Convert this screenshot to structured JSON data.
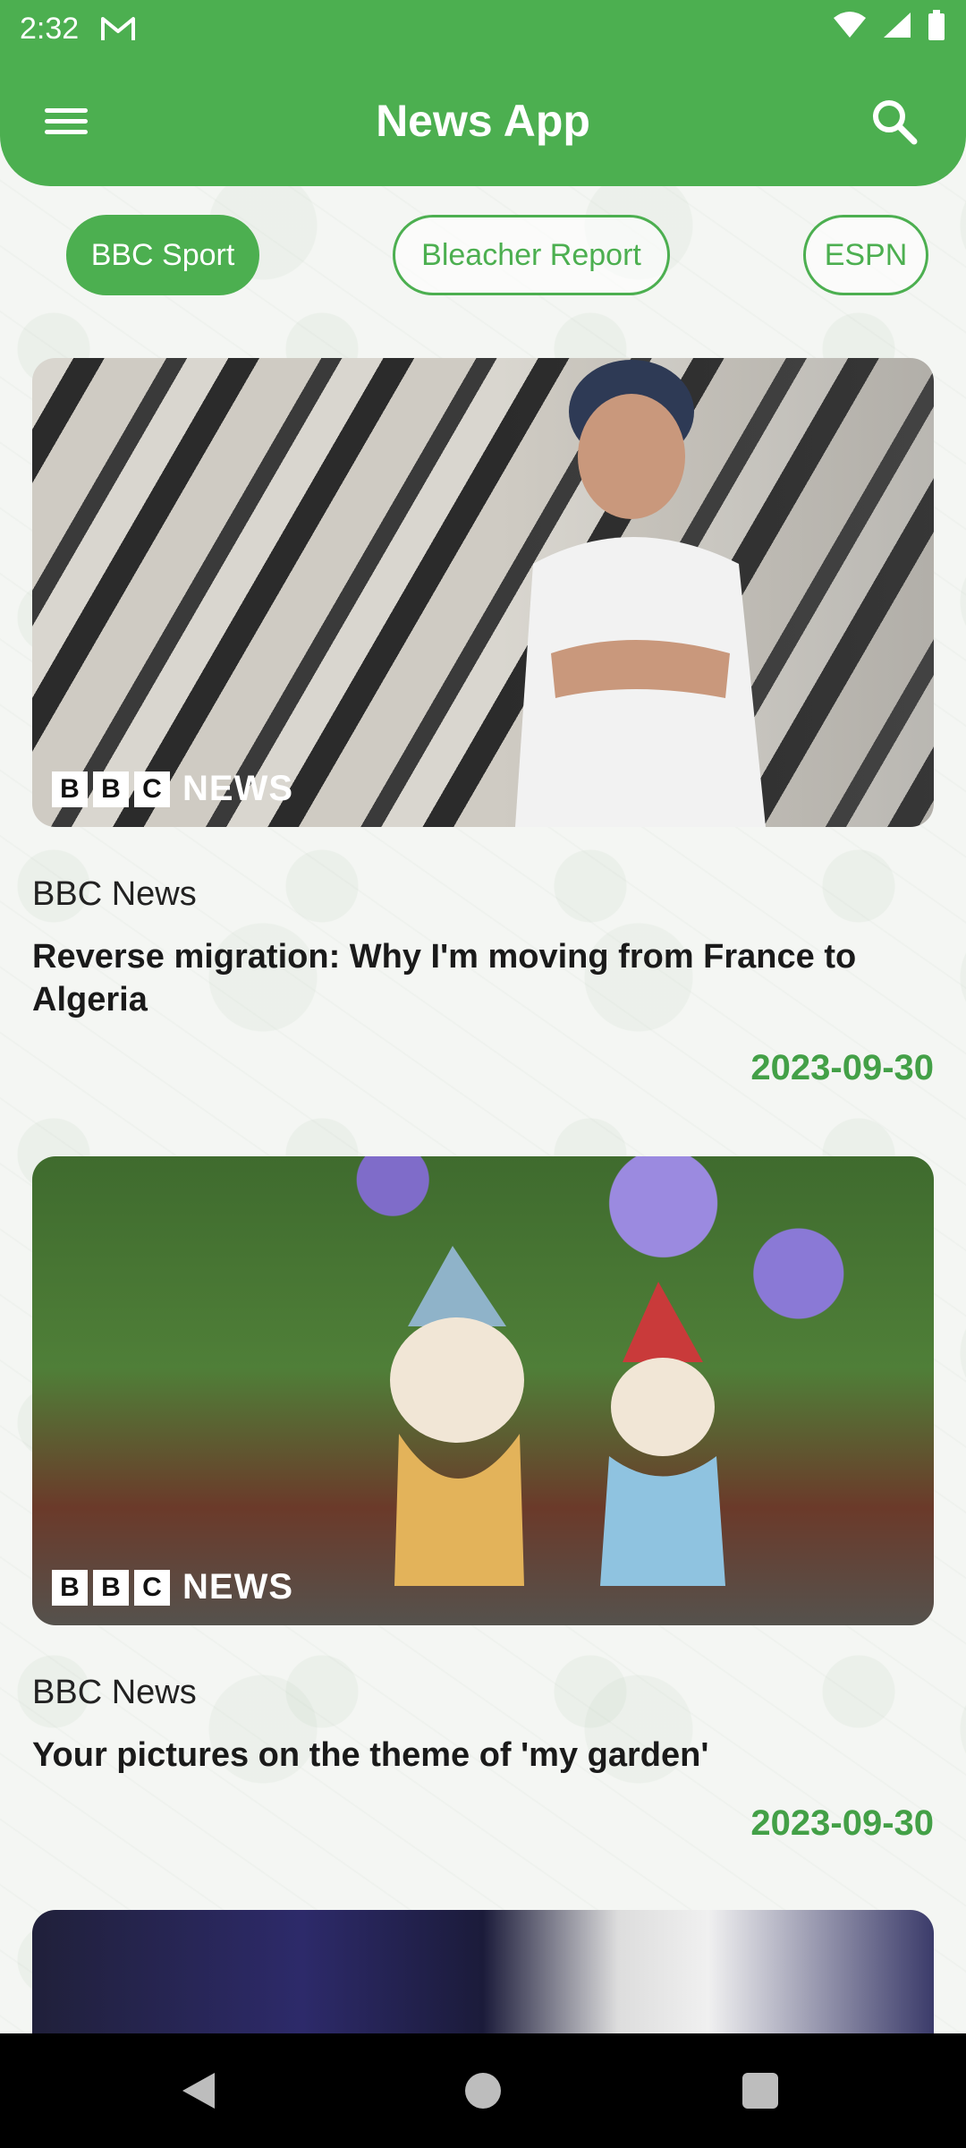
{
  "status_bar": {
    "time": "2:32"
  },
  "app_bar": {
    "title": "News App"
  },
  "chips": [
    "BBC Sport",
    "Bleacher Report",
    "ESPN"
  ],
  "logo": {
    "blocks": [
      "B",
      "B",
      "C"
    ],
    "word": "NEWS"
  },
  "articles": [
    {
      "source": "BBC News",
      "headline": "Reverse migration: Why I'm moving from France to Algeria",
      "date": "2023-09-30"
    },
    {
      "source": "BBC News",
      "headline": "Your pictures on the theme of 'my garden'",
      "date": "2023-09-30"
    }
  ],
  "theme": {
    "primary": "#4caf50",
    "date_color": "#43a047"
  }
}
